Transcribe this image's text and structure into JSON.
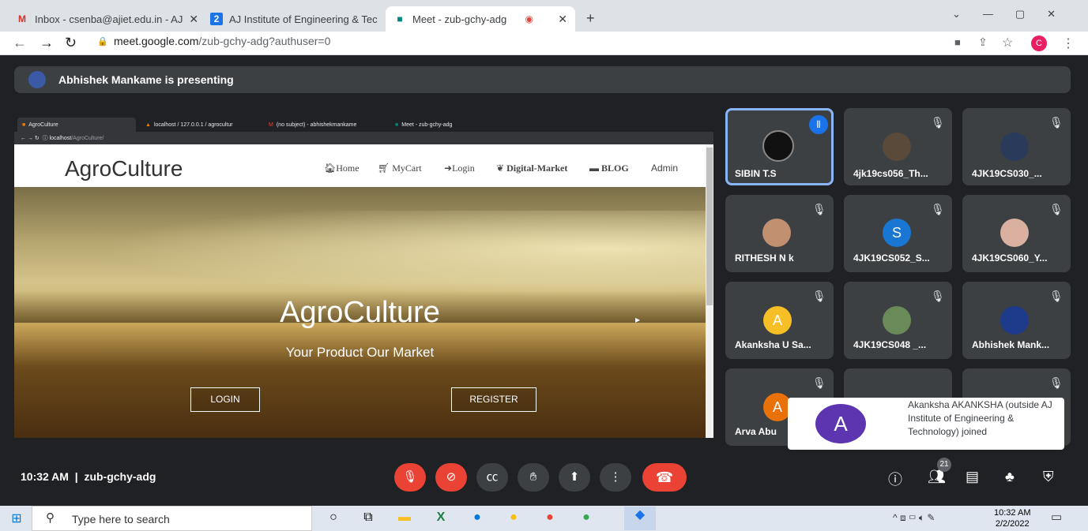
{
  "browser": {
    "tabs": [
      {
        "title": "Inbox - csenba@ajiet.edu.in - AJ"
      },
      {
        "title": "AJ Institute of Engineering & Tec"
      },
      {
        "title": "Meet - zub-gchy-adg"
      }
    ],
    "url_host": "meet.google.com",
    "url_path": "/zub-gchy-adg?authuser=0",
    "profile_initial": "C"
  },
  "presenting": {
    "text": "Abhishek Mankame is presenting"
  },
  "shared": {
    "tabs": [
      {
        "title": "AgroCulture"
      },
      {
        "title": "localhost / 127.0.0.1 / agrocultur"
      },
      {
        "title": "(no subject) - abhishekmankame"
      },
      {
        "title": "Meet - zub-gchy-adg"
      }
    ],
    "url_host": "localhost",
    "url_path": "/AgroCulture/",
    "logo": "AgroCulture",
    "nav": [
      {
        "label": "Home"
      },
      {
        "label": "MyCart"
      },
      {
        "label": "Login"
      },
      {
        "label": "Digital-Market"
      },
      {
        "label": "BLOG"
      },
      {
        "label": "Admin"
      }
    ],
    "hero_title": "AgroCulture",
    "hero_subtitle": "Your Product Our Market",
    "login_label": "LOGIN",
    "register_label": "REGISTER"
  },
  "participants": [
    {
      "name": "SIBIN T.S"
    },
    {
      "name": "4jk19cs056_Th..."
    },
    {
      "name": "4JK19CS030_..."
    },
    {
      "name": "RITHESH N k"
    },
    {
      "name": "4JK19CS052_S...",
      "initial": "S"
    },
    {
      "name": "4JK19CS060_Y..."
    },
    {
      "name": "Akanksha U Sa...",
      "initial": "A"
    },
    {
      "name": "4JK19CS048 _..."
    },
    {
      "name": "Abhishek Mank..."
    },
    {
      "name": "Arva Abu",
      "initial": "A"
    }
  ],
  "toast": {
    "initial": "A",
    "text": "Akanksha AKANKSHA (outside AJ Institute of Engineering & Technology) joined"
  },
  "meeting": {
    "time": "10:32 AM",
    "code": "zub-gchy-adg",
    "participant_count": "21"
  },
  "taskbar": {
    "search_placeholder": "Type here to search",
    "time": "10:32 AM",
    "date": "2/2/2022"
  }
}
